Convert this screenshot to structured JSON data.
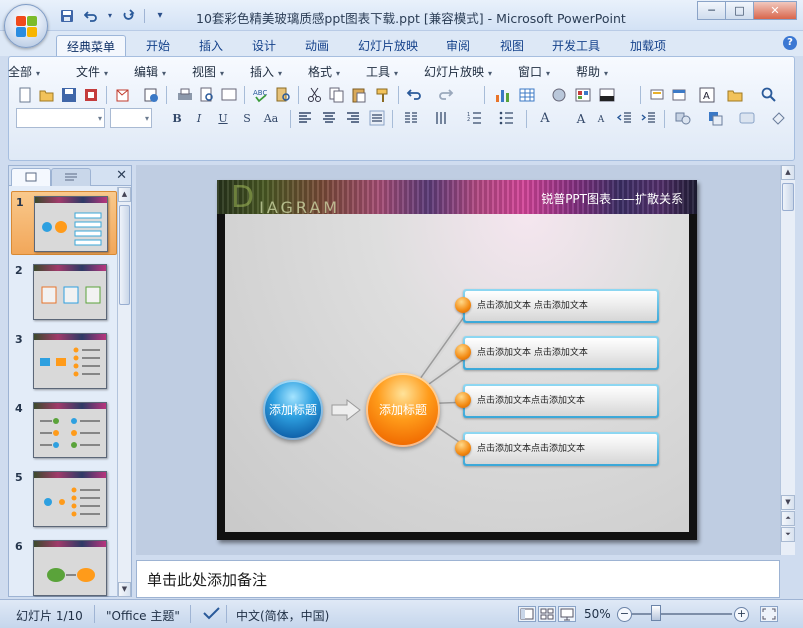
{
  "window": {
    "title": "10套彩色精美玻璃质感ppt图表下载.ppt [兼容模式] - Microsoft PowerPoint",
    "controls": {
      "minimize": "─",
      "maximize": "□",
      "close": "✕"
    }
  },
  "quick_access": {
    "icons": [
      "save-icon",
      "undo-icon",
      "redo-icon",
      "customize-icon"
    ],
    "customize": "▾"
  },
  "ribbon_tabs": [
    "经典菜单",
    "开始",
    "插入",
    "设计",
    "动画",
    "幻灯片放映",
    "审阅",
    "视图",
    "开发工具",
    "加载项"
  ],
  "ribbon_active_tab": "经典菜单",
  "help": "?",
  "classic_menu": [
    "全部",
    "文件",
    "编辑",
    "视图",
    "插入",
    "格式",
    "工具",
    "幻灯片放映",
    "窗口",
    "帮助"
  ],
  "format_buttons": {
    "bold": "B",
    "italic": "I",
    "underline": "U",
    "shadow": "S",
    "case": "Aa",
    "textbox": "A",
    "grow": "A",
    "shrink": "A"
  },
  "pane_close": "✕",
  "thumbnails": [
    {
      "number": "1",
      "selected": true
    },
    {
      "number": "2",
      "selected": false
    },
    {
      "number": "3",
      "selected": false
    },
    {
      "number": "4",
      "selected": false
    },
    {
      "number": "5",
      "selected": false
    },
    {
      "number": "6",
      "selected": false
    }
  ],
  "slide": {
    "banner_word_first": "D",
    "banner_word_rest": "IAGRAM",
    "subtitle": "锐普PPT图表——扩散关系",
    "left_circle": "添加标题",
    "center_circle": "添加标题",
    "items": [
      "点击添加文本 点击添加文本",
      "点击添加文本 点击添加文本",
      "点击添加文本点击添加文本",
      "点击添加文本点击添加文本"
    ]
  },
  "notes_placeholder": "单击此处添加备注",
  "status": {
    "slide_info": "幻灯片 1/10",
    "theme": "\"Office 主题\"",
    "language": "中文(简体，中国)",
    "zoom": "50%",
    "zoom_out": "−",
    "zoom_in": "+"
  },
  "colors": {
    "accent_blue": "#2ea0e0",
    "accent_orange": "#ff9b1a",
    "selected_thumb": "#f2a75a"
  }
}
